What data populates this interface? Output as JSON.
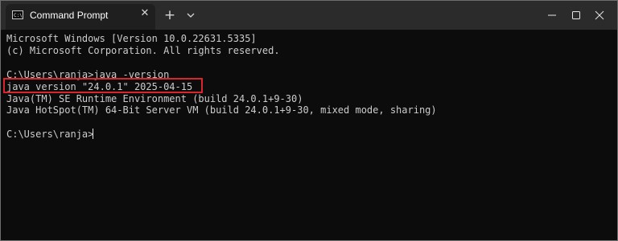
{
  "window": {
    "tab_title": "Command Prompt",
    "tab_icon_text": "C:\\",
    "tab_icon": "terminal-icon",
    "close_tab_icon": "close-icon",
    "new_tab_label": "+",
    "dropdown_icon": "chevron-down-icon",
    "controls": [
      "minimize-icon",
      "maximize-icon",
      "close-icon"
    ]
  },
  "console": {
    "lines": [
      "Microsoft Windows [Version 10.0.22631.5335]",
      "(c) Microsoft Corporation. All rights reserved.",
      "C:\\Users\\ranja>java -version",
      "java version \"24.0.1\" 2025-04-15",
      "Java(TM) SE Runtime Environment (build 24.0.1+9-30)",
      "Java HotSpot(TM) 64-Bit Server VM (build 24.0.1+9-30, mixed mode, sharing)",
      "C:\\Users\\ranja>"
    ],
    "highlight_color": "#d9262c"
  },
  "colors": {
    "console_bg": "#0c0c0c",
    "titlebar_bg": "#2b2b2b",
    "tab_bg": "#1f1f1f",
    "text": "#cccccc"
  }
}
